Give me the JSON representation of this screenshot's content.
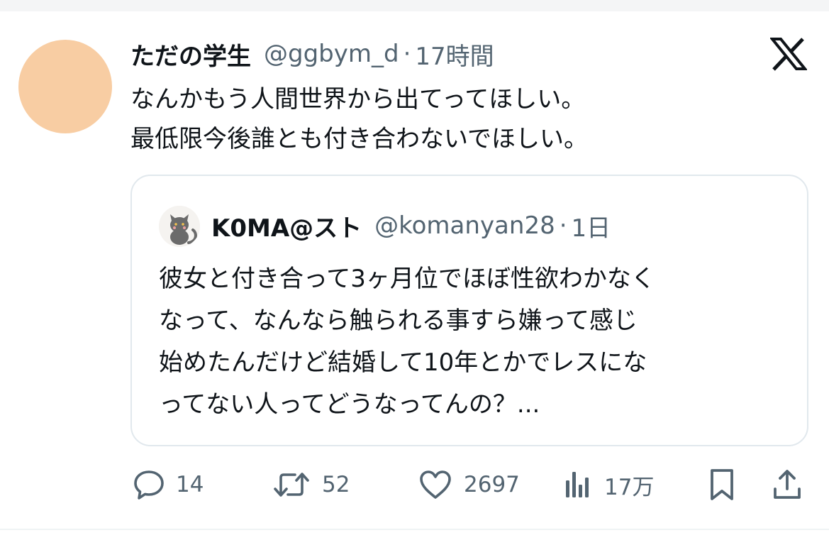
{
  "tweet": {
    "display_name": "ただの学生",
    "handle": "@ggbym_d",
    "separator": "·",
    "time": "17時間",
    "text_lines": [
      "なんかもう人間世界から出てってほしい。",
      "最低限今後誰とも付き合わないでほしい。"
    ]
  },
  "quote": {
    "display_name": "K0MA@スト",
    "handle": "@komanyan28",
    "separator": "·",
    "time": "1日",
    "text_lines": [
      "彼女と付き合って3ヶ月位でほぼ性欲わかなく",
      "なって、なんなら触られる事すら嫌って感じ",
      "始めたんだけど結婚して10年とかでレスにな",
      "ってない人ってどうなってんの？..."
    ]
  },
  "actions": {
    "replies": "14",
    "reposts": "52",
    "likes": "2697",
    "views": "17万"
  },
  "colors": {
    "avatar": "#f8cda3",
    "secondary_text": "#536471",
    "primary_text": "#0f1419",
    "border": "#e1e8ed"
  },
  "icons": [
    "x-logo-icon",
    "reply-icon",
    "repost-icon",
    "like-icon",
    "views-icon",
    "bookmark-icon",
    "share-icon"
  ]
}
